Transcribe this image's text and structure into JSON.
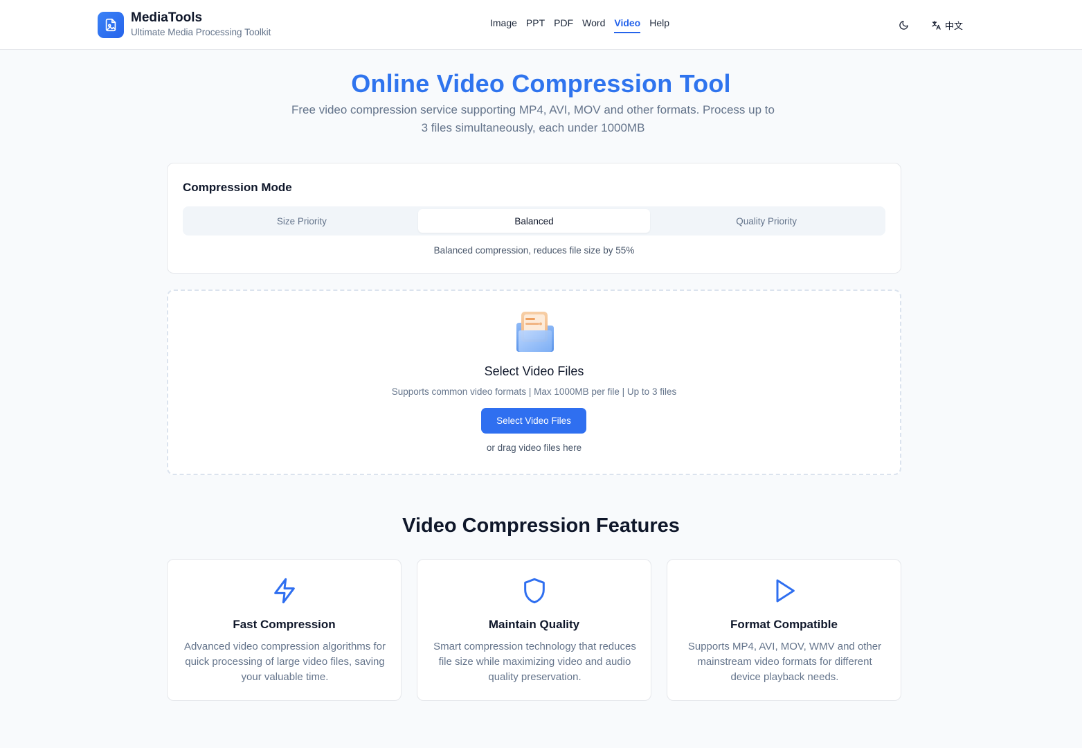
{
  "header": {
    "app_name": "MediaTools",
    "tagline": "Ultimate Media Processing Toolkit",
    "nav": [
      "Image",
      "PPT",
      "PDF",
      "Word",
      "Video",
      "Help"
    ],
    "active_nav": "Video",
    "language_label": "中文",
    "theme_icon": "moon-icon",
    "language_icon": "translate-icon"
  },
  "hero": {
    "title": "Online Video Compression Tool",
    "subtitle": "Free video compression service supporting MP4, AVI, MOV and other formats. Process up to 3 files simultaneously, each under 1000MB"
  },
  "compression": {
    "title": "Compression Mode",
    "modes": [
      "Size Priority",
      "Balanced",
      "Quality Priority"
    ],
    "selected": "Balanced",
    "description": "Balanced compression, reduces file size by 55%"
  },
  "upload": {
    "title": "Select Video Files",
    "hint": "Supports common video formats | Max 1000MB per file | Up to 3 files",
    "button_label": "Select Video Files",
    "drag_text": "or drag video files here",
    "icon": "folder-icon"
  },
  "features": {
    "title": "Video Compression Features",
    "items": [
      {
        "icon": "lightning-icon",
        "title": "Fast Compression",
        "desc": "Advanced video compression algorithms for quick processing of large video files, saving your valuable time."
      },
      {
        "icon": "shield-icon",
        "title": "Maintain Quality",
        "desc": "Smart compression technology that reduces file size while maximizing video and audio quality preservation."
      },
      {
        "icon": "play-icon",
        "title": "Format Compatible",
        "desc": "Supports MP4, AVI, MOV, WMV and other mainstream video formats for different device playback needs."
      }
    ]
  },
  "colors": {
    "accent": "#2f6ff0",
    "title_blue": "#2f74ee",
    "background": "#f8fafc"
  }
}
